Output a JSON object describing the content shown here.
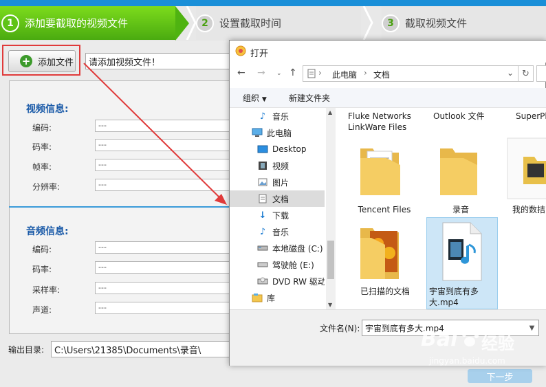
{
  "steps": [
    {
      "num": "1",
      "label": "添加要截取的视频文件"
    },
    {
      "num": "2",
      "label": "设置截取时间"
    },
    {
      "num": "3",
      "label": "截取视频文件"
    }
  ],
  "main": {
    "add_button_label": "添加文件",
    "file_input_value": "请添加视频文件！",
    "video_section": {
      "title": "视频信息:",
      "fields": [
        {
          "label": "编码:",
          "value": "---"
        },
        {
          "label": "码率:",
          "value": "---"
        },
        {
          "label": "帧率:",
          "value": "---"
        },
        {
          "label": "分辨率:",
          "value": "---"
        }
      ]
    },
    "audio_section": {
      "title": "音频信息:",
      "fields": [
        {
          "label": "编码:",
          "value": "---"
        },
        {
          "label": "码率:",
          "value": "---"
        },
        {
          "label": "采样率:",
          "value": "---"
        },
        {
          "label": "声道:",
          "value": "---"
        }
      ]
    },
    "output_label": "输出目录:",
    "output_value": "C:\\Users\\21385\\Documents\\录音\\",
    "next_button_label": "下一步"
  },
  "dialog": {
    "title": "打开",
    "breadcrumb": [
      "此电脑",
      "文档"
    ],
    "toolbar": {
      "organize": "组织",
      "new_folder": "新建文件夹"
    },
    "nav_items": [
      {
        "label": "音乐",
        "icon": "music-icon"
      },
      {
        "label": "此电脑",
        "icon": "computer-icon"
      },
      {
        "label": "Desktop",
        "icon": "desktop-icon"
      },
      {
        "label": "视频",
        "icon": "video-icon"
      },
      {
        "label": "图片",
        "icon": "picture-icon"
      },
      {
        "label": "文档",
        "icon": "document-icon",
        "selected": true
      },
      {
        "label": "下载",
        "icon": "download-icon"
      },
      {
        "label": "音乐",
        "icon": "music-icon"
      },
      {
        "label": "本地磁盘 (C:)",
        "icon": "disk-icon"
      },
      {
        "label": "驾驶舱 (E:)",
        "icon": "disk-icon"
      },
      {
        "label": "DVD RW 驱动",
        "icon": "dvd-icon"
      },
      {
        "label": "库",
        "icon": "library-icon"
      }
    ],
    "files": [
      {
        "name": "Fluke Networks LinkWare Files",
        "type": "folder"
      },
      {
        "name": "Outlook 文件",
        "type": "folder"
      },
      {
        "name": "SuperPl",
        "type": "folder"
      },
      {
        "name": "Tencent Files",
        "type": "folder"
      },
      {
        "name": "录音",
        "type": "folder"
      },
      {
        "name": "我的数拮",
        "type": "folder"
      },
      {
        "name": "已扫描的文档",
        "type": "folder"
      },
      {
        "name": "宇宙到底有多大.mp4",
        "type": "video",
        "selected": true
      }
    ],
    "filename_label": "文件名(N):",
    "filename_value": "宇宙到底有多大.mp4"
  },
  "watermark": {
    "brand": "Bai",
    "brand2": "经验",
    "url": "jingyan.baidu.com"
  },
  "colors": {
    "accent_green": "#4aab10",
    "accent_blue": "#1a8fd8",
    "annotation_red": "#e03a3a",
    "selection_blue": "#cde6f7"
  }
}
